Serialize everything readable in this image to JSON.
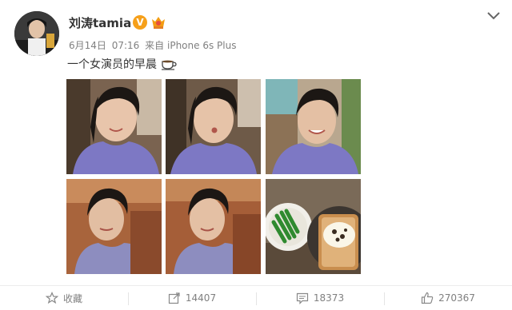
{
  "post": {
    "username": "刘涛tamia",
    "verified_badge": "V",
    "vip_icon": "vip-crown-icon",
    "date": "6月14日",
    "time": "07:16",
    "source_prefix": "来自",
    "source": "iPhone 6s Plus",
    "text": "一个女演员的早晨",
    "text_emoji": "coffee-cup-icon"
  },
  "photos": [
    {
      "label": "selfie-smile"
    },
    {
      "label": "selfie-pout"
    },
    {
      "label": "selfie-laugh"
    },
    {
      "label": "selfie-reclined-1"
    },
    {
      "label": "selfie-reclined-2"
    },
    {
      "label": "breakfast"
    }
  ],
  "actions": {
    "favorite": "收藏",
    "repost_count": "14407",
    "comment_count": "18373",
    "like_count": "270367"
  },
  "colors": {
    "badge_orange": "#f6a01a",
    "meta_gray": "#808080",
    "shirt_purple": "#7d78c4"
  }
}
